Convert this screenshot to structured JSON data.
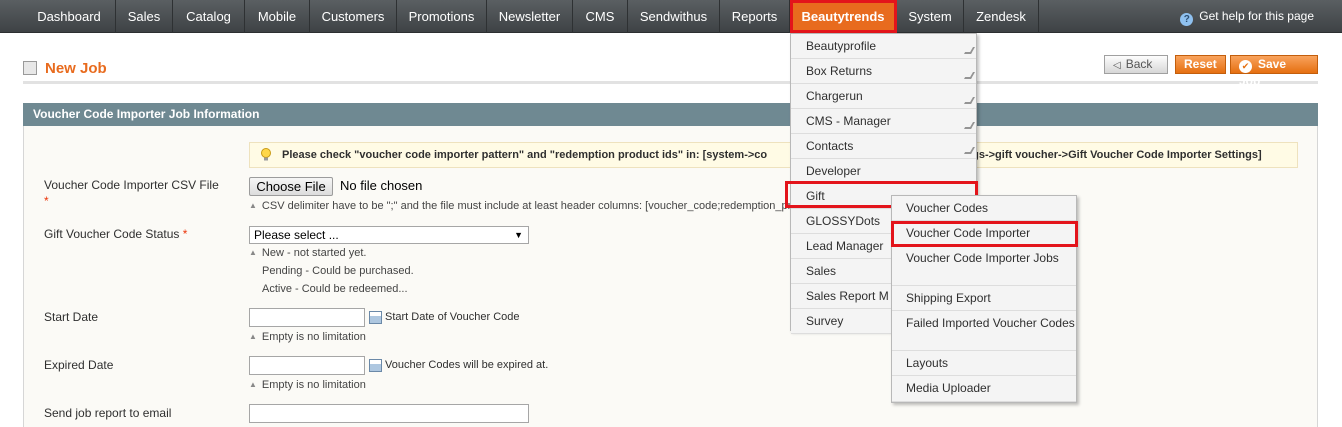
{
  "nav": {
    "items": [
      "Dashboard",
      "Sales",
      "Catalog",
      "Mobile",
      "Customers",
      "Promotions",
      "Newsletter",
      "CMS",
      "Sendwithus",
      "Reports",
      "Beautytrends",
      "System",
      "Zendesk"
    ],
    "active": "Beautytrends",
    "help": "Get help for this page"
  },
  "page": {
    "title": "New Job",
    "back_label": "Back",
    "reset_label": "Reset",
    "save_label": "Save Job"
  },
  "box": {
    "header": "Voucher Code Importer Job Information",
    "notice_start": "Please check \"voucher code importer pattern\" and \"redemption product ids\" in: [system->co",
    "notice_end": "gs->gift voucher->Gift Voucher Code Importer Settings]"
  },
  "form": {
    "csv_label": "Voucher Code Importer CSV File",
    "csv_required": "*",
    "choose_file": "Choose File",
    "no_file": "No file chosen",
    "csv_hint": "CSV delimiter have to be \";\" and the file must include at least header columns: [voucher_code;redemption_pro",
    "status_label": "Gift Voucher Code Status",
    "status_required": "*",
    "status_value": "Please select ...",
    "status_hint_1": "New - not started yet.",
    "status_hint_2": "Pending - Could be purchased.",
    "status_hint_3": "Active - Could be redeemed...",
    "start_label": "Start Date",
    "start_cal_text": "Start Date of Voucher Code",
    "start_hint": "Empty is no limitation",
    "expired_label": "Expired Date",
    "expired_cal_text": "Voucher Codes will be expired at.",
    "expired_hint": "Empty is no limitation",
    "email_label": "Send job report to email"
  },
  "menu_beautytrends": [
    "Beautyprofile",
    "Box Returns",
    "Chargerun",
    "CMS - Manager",
    "Contacts",
    "Developer",
    "Gift",
    "GLOSSYDots",
    "Lead Manager",
    "Sales",
    "Sales Report M",
    "Survey"
  ],
  "menu_gift": [
    "Voucher Codes",
    "Voucher Code Importer",
    "Voucher Code Importer Jobs",
    "Shipping Export",
    "Failed Imported Voucher Codes",
    "Layouts",
    "Media Uploader"
  ],
  "colors": {
    "accent": "#e86b1e",
    "highlight_box": "#e3141b",
    "box_header": "#6f8992"
  }
}
